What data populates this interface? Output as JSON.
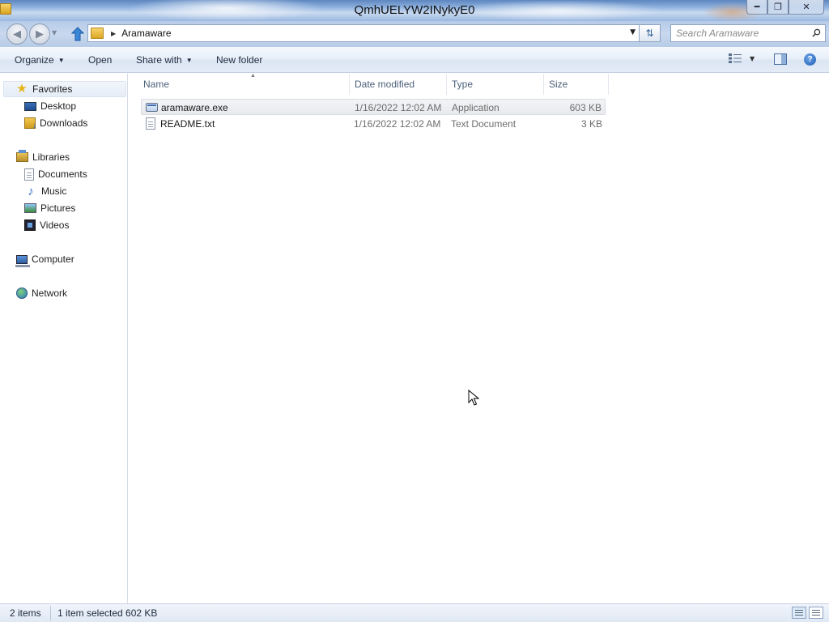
{
  "window": {
    "title": "QmhUELYW2INykyE0",
    "controls": [
      "minimize-icon",
      "maximize-icon",
      "close-icon"
    ]
  },
  "navbar": {
    "breadcrumb": [
      "Aramaware"
    ],
    "search_placeholder": "Search Aramaware"
  },
  "commands": {
    "organize": "Organize",
    "open": "Open",
    "share_with": "Share with",
    "new_folder": "New folder"
  },
  "navpane": {
    "favorites": "Favorites",
    "desktop": "Desktop",
    "downloads": "Downloads",
    "libraries": "Libraries",
    "documents": "Documents",
    "music": "Music",
    "pictures": "Pictures",
    "videos": "Videos",
    "computer": "Computer",
    "network": "Network"
  },
  "columns": {
    "name": "Name",
    "date_modified": "Date modified",
    "type": "Type",
    "size": "Size"
  },
  "files": [
    {
      "name": "aramaware.exe",
      "date": "1/16/2022 12:02 AM",
      "type": "Application",
      "size": "603 KB",
      "selected": true,
      "icon": "application-icon"
    },
    {
      "name": "README.txt",
      "date": "1/16/2022 12:02 AM",
      "type": "Text Document",
      "size": "3 KB",
      "selected": false,
      "icon": "text-file-icon"
    }
  ],
  "status": {
    "item_count": "2 items",
    "selection": "1 item selected  602 KB"
  }
}
